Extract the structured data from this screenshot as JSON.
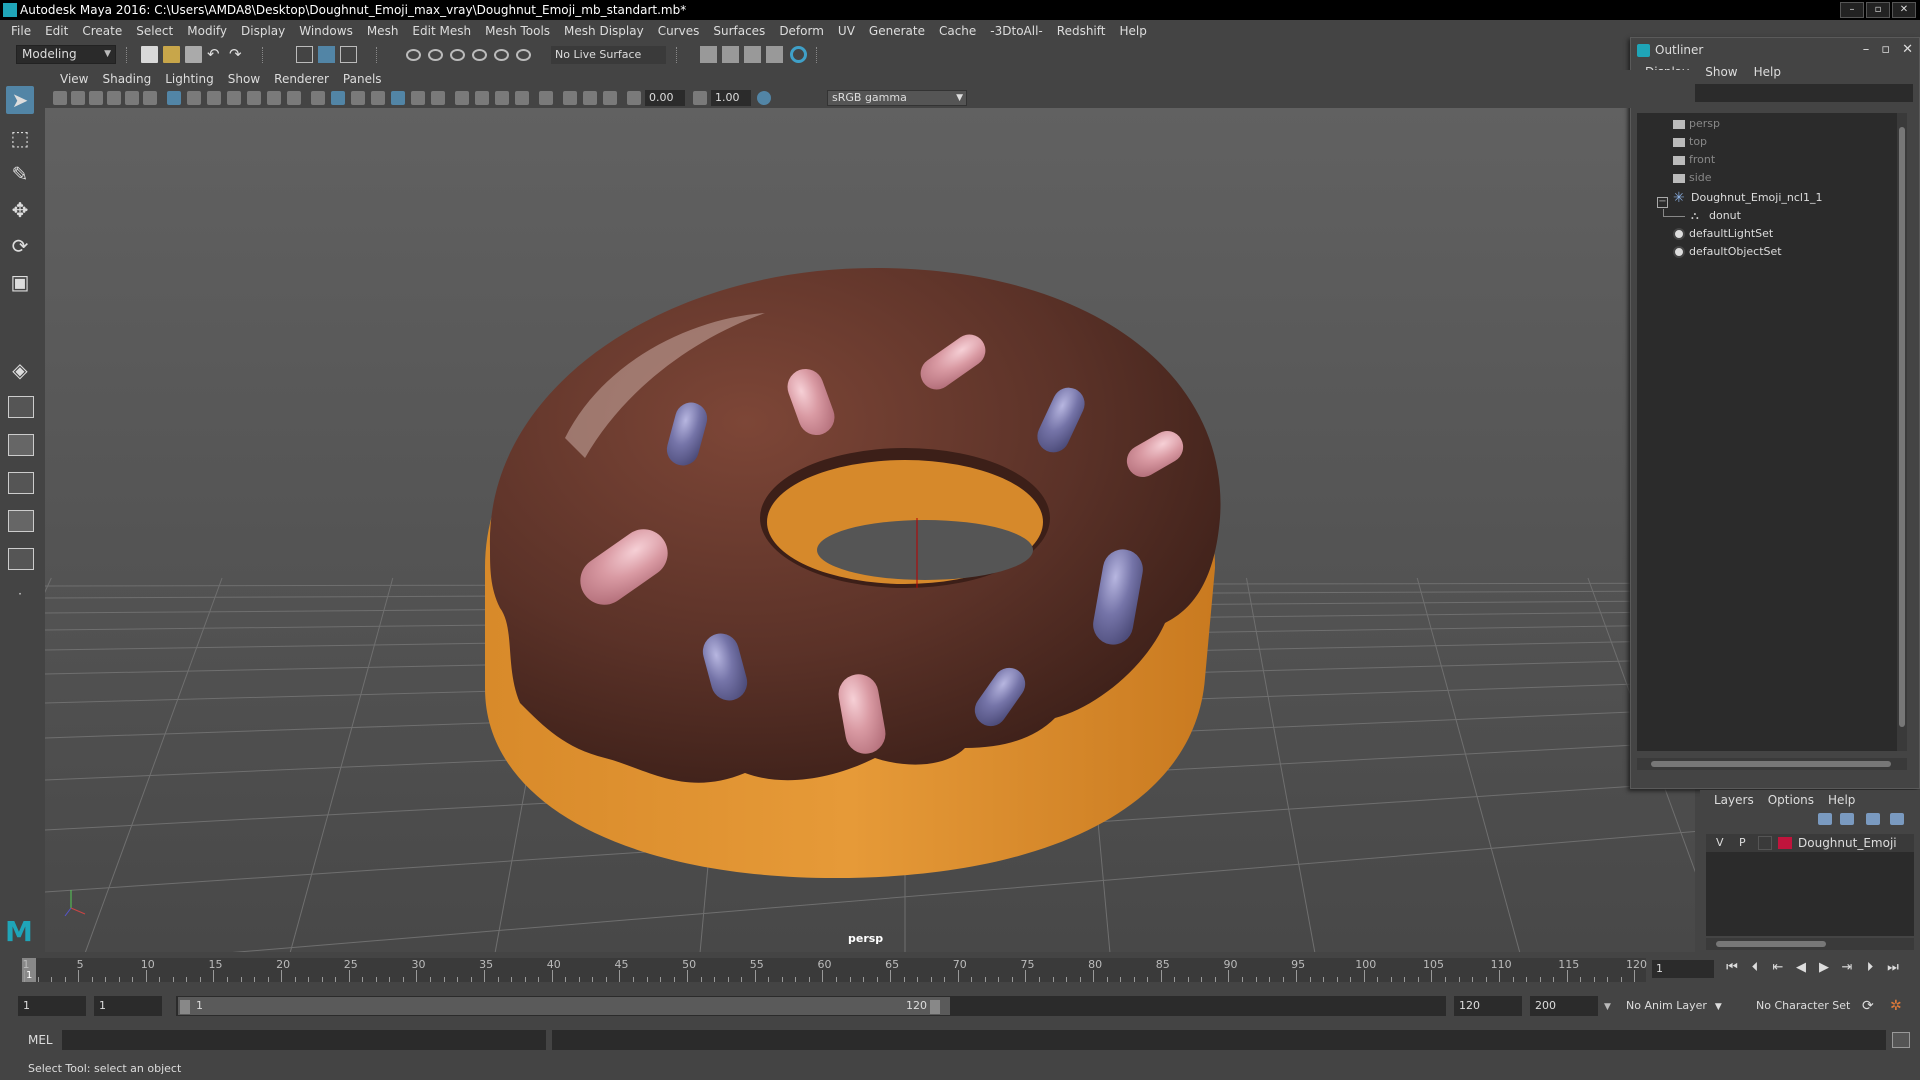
{
  "window": {
    "title": "Autodesk Maya 2016: C:\\Users\\AMDA8\\Desktop\\Doughnut_Emoji_max_vray\\Doughnut_Emoji_mb_standart.mb*"
  },
  "menubar": [
    "File",
    "Edit",
    "Create",
    "Select",
    "Modify",
    "Display",
    "Windows",
    "Mesh",
    "Edit Mesh",
    "Mesh Tools",
    "Mesh Display",
    "Curves",
    "Surfaces",
    "Deform",
    "UV",
    "Generate",
    "Cache",
    "-3DtoAll-",
    "Redshift",
    "Help"
  ],
  "statusline": {
    "mode": "Modeling",
    "live_surface": "No Live Surface"
  },
  "viewport": {
    "menus": [
      "View",
      "Shading",
      "Lighting",
      "Show",
      "Renderer",
      "Panels"
    ],
    "exposure": "0.00",
    "gamma": "1.00",
    "color_space": "sRGB gamma",
    "camera": "persp"
  },
  "outliner": {
    "title": "Outliner",
    "menus": [
      "Display",
      "Show",
      "Help"
    ],
    "items": [
      {
        "label": "persp",
        "icon": "camera-icon",
        "dim": true
      },
      {
        "label": "top",
        "icon": "camera-icon",
        "dim": true
      },
      {
        "label": "front",
        "icon": "camera-icon",
        "dim": true
      },
      {
        "label": "side",
        "icon": "camera-icon",
        "dim": true
      },
      {
        "label": "Doughnut_Emoji_ncl1_1",
        "icon": "group-icon",
        "dim": false
      },
      {
        "label": "donut",
        "icon": "mesh-icon",
        "dim": false
      },
      {
        "label": "defaultLightSet",
        "icon": "set-icon",
        "dim": false
      },
      {
        "label": "defaultObjectSet",
        "icon": "set-icon",
        "dim": false
      }
    ]
  },
  "layers": {
    "menus": [
      "Layers",
      "Options",
      "Help"
    ],
    "rows": [
      {
        "visible": "V",
        "playback": "P",
        "name": "Doughnut_Emoji",
        "color": "#c0143c"
      }
    ]
  },
  "timeslider": {
    "tick_labels": [
      "1",
      "5",
      "10",
      "15",
      "20",
      "25",
      "30",
      "35",
      "40",
      "45",
      "50",
      "55",
      "60",
      "65",
      "70",
      "75",
      "80",
      "85",
      "90",
      "95",
      "100",
      "105",
      "110",
      "115",
      "120"
    ],
    "current_frame": "1"
  },
  "rangeslider": {
    "start": "1",
    "playback_start": "1",
    "range_start": "1",
    "range_end": "120",
    "playback_end": "120",
    "end": "200",
    "anim_layer": "No Anim Layer",
    "character_set": "No Character Set"
  },
  "cmdline": {
    "language": "MEL"
  },
  "helpline": {
    "text": "Select Tool: select an object"
  },
  "colors": {
    "accent": "#5285a6",
    "maya_teal": "#1fa5b8",
    "layer_color": "#c0143c"
  }
}
